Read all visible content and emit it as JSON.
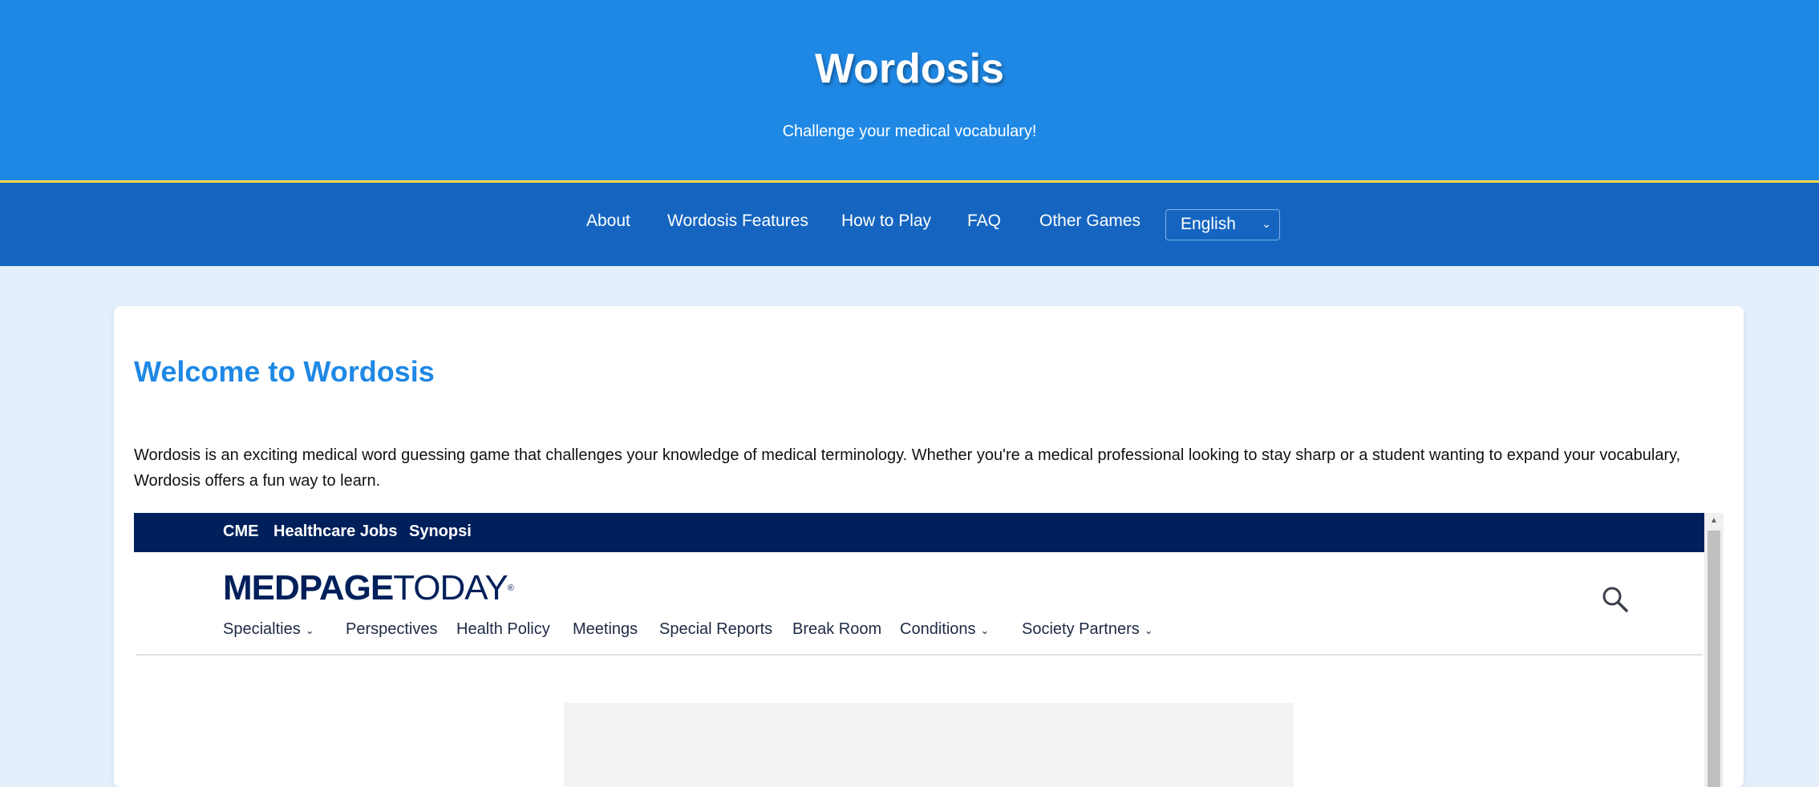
{
  "hero": {
    "title": "Wordosis",
    "subtitle": "Challenge your medical vocabulary!"
  },
  "nav": {
    "items": [
      "About",
      "Wordosis Features",
      "How to Play",
      "FAQ",
      "Other Games"
    ],
    "language": {
      "selected": "English"
    }
  },
  "main": {
    "heading": "Welcome to Wordosis",
    "intro": "Wordosis is an exciting medical word guessing game that challenges your knowledge of medical terminology. Whether you're a medical professional looking to stay sharp or a student wanting to expand your vocabulary, Wordosis offers a fun way to learn."
  },
  "embed": {
    "topbar": [
      "CME",
      "Healthcare Jobs",
      "Synopsi"
    ],
    "logo": {
      "part1": "MEDPAGE",
      "part2": "TODAY",
      "mark": "®"
    },
    "nav": [
      "Specialties",
      "Perspectives",
      "Health Policy",
      "Meetings",
      "Special Reports",
      "Break Room",
      "Conditions",
      "Society Partners"
    ]
  },
  "colors": {
    "hero": "#1f88e5",
    "nav": "#1565c0",
    "accent_border": "#ffd84d",
    "heading": "#1f88e5",
    "medpage_navy": "#00205b",
    "page_bg": "#e3f0fc"
  },
  "icons": [
    "search-icon",
    "chevron-down-icon",
    "scroll-up-icon"
  ]
}
